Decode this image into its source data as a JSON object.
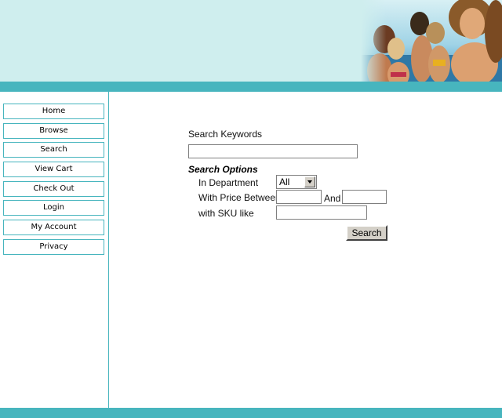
{
  "nav": {
    "items": [
      {
        "label": "Home"
      },
      {
        "label": "Browse"
      },
      {
        "label": "Search"
      },
      {
        "label": "View Cart"
      },
      {
        "label": "Check Out"
      },
      {
        "label": "Login"
      },
      {
        "label": "My Account"
      },
      {
        "label": "Privacy"
      }
    ]
  },
  "search": {
    "keywords_label": "Search Keywords",
    "keywords_value": "",
    "options_title": "Search Options",
    "department_label": "In Department",
    "department_value": "All",
    "price_label": "With Price Between",
    "price_min": "",
    "and_label": "And",
    "price_max": "",
    "sku_label": "with SKU like",
    "sku_value": "",
    "button_label": "Search"
  },
  "colors": {
    "header_bg": "#cfeeee",
    "accent_teal": "#47b5be"
  }
}
